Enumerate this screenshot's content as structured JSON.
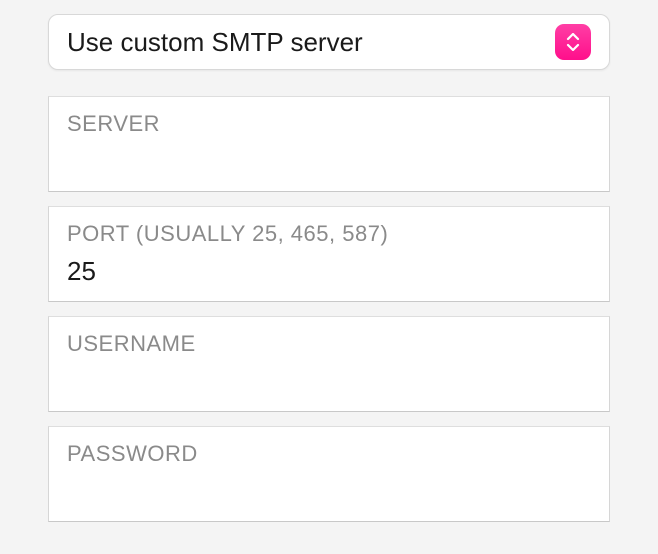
{
  "dropdown": {
    "selected_label": "Use custom SMTP server"
  },
  "fields": {
    "server": {
      "label": "SERVER",
      "value": ""
    },
    "port": {
      "label": "PORT (USUALLY 25, 465, 587)",
      "value": "25"
    },
    "username": {
      "label": "USERNAME",
      "value": ""
    },
    "password": {
      "label": "PASSWORD",
      "value": ""
    }
  }
}
